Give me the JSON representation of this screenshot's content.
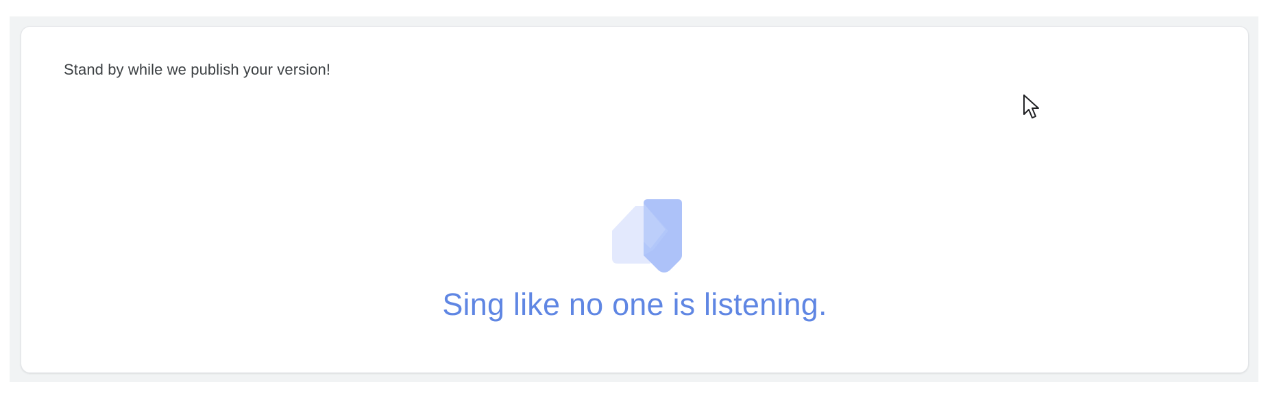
{
  "publish_panel": {
    "status_message": "Stand by while we publish your version!",
    "tagline": "Sing like no one is listening.",
    "icon": "publish-loading-logo",
    "colors": {
      "accent": "#5f86e3",
      "logo_light": "#e3e9fd",
      "logo_mid": "#c6d4fb",
      "logo_dark": "#adc2f9",
      "text": "#3c4043"
    }
  },
  "cursor": {
    "icon": "mouse-pointer-icon"
  }
}
